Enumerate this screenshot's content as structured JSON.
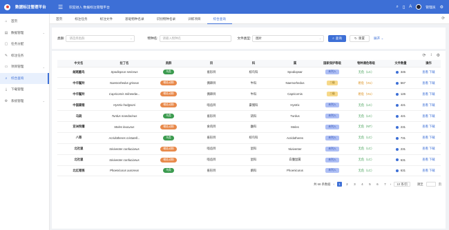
{
  "header": {
    "app_title": "数据标注管理平台",
    "welcome": "欢迎进入 数据标注管理平台",
    "user_name": "管理员"
  },
  "sidebar": {
    "items": [
      {
        "label": "首页",
        "icon": "home-icon",
        "has_children": false
      },
      {
        "label": "数据管理",
        "icon": "database-icon",
        "has_children": true
      },
      {
        "label": "任务分配",
        "icon": "task-icon",
        "has_children": false
      },
      {
        "label": "标注任务",
        "icon": "edit-icon",
        "has_children": false
      },
      {
        "label": "项目管理",
        "icon": "folder-icon",
        "has_children": true
      },
      {
        "label": "综合查询",
        "icon": "search-icon",
        "has_children": false,
        "active": true
      },
      {
        "label": "下载管理",
        "icon": "download-icon",
        "has_children": false
      },
      {
        "label": "系统管理",
        "icon": "gear-icon",
        "has_children": true
      }
    ]
  },
  "tabs": [
    {
      "label": "首页",
      "active": false
    },
    {
      "label": "标注任务",
      "active": false
    },
    {
      "label": "标注文件",
      "active": false
    },
    {
      "label": "基础物种名录",
      "active": false
    },
    {
      "label": "识别物种名录",
      "active": false
    },
    {
      "label": "训练项目",
      "active": false
    },
    {
      "label": "综合查询",
      "active": true
    }
  ],
  "filter": {
    "category_label": "类群:",
    "category_placeholder": "请选择类群",
    "species_label": "物种名:",
    "species_placeholder": "请输入物种名",
    "filetype_label": "文件类型:",
    "filetype_value": "图片",
    "query_label": "查询",
    "reset_label": "重置",
    "expand_label": "展开"
  },
  "table": {
    "columns": [
      "中文名",
      "拉丁名",
      "类群",
      "目",
      "科",
      "属",
      "国家保护等级",
      "物种濒危等级",
      "文件数量",
      "操作"
    ],
    "rows": [
      {
        "cn": "絨尾鼯鸟",
        "latin": "Spodiopsar sericeus",
        "group": "鸟类",
        "group_color": "green",
        "order": "雀形目",
        "family": "椋鸟科",
        "genus": "Spodiopsar",
        "protect": "未列入",
        "protect_color": "blue",
        "iucn": "无危（LC）",
        "iucn_color": "green",
        "files": "345"
      },
      {
        "cn": "中华鬣羚",
        "latin": "Naemorhedus griseus",
        "group": "哺乳动物",
        "group_color": "orange",
        "order": "偶蹄目",
        "family": "牛科",
        "genus": "Naemorhedus",
        "protect": "二级",
        "protect_color": "yellow",
        "iucn": "易危（VU）",
        "iucn_color": "orange",
        "files": "567"
      },
      {
        "cn": "中华鬣羚",
        "latin": "Capricornis milneedw...",
        "group": "哺乳动物",
        "group_color": "orange",
        "order": "偶蹄目",
        "family": "牛科",
        "genus": "Capricornis",
        "protect": "二级",
        "protect_color": "yellow",
        "iucn": "易危（VU）",
        "iucn_color": "orange",
        "files": "126"
      },
      {
        "cn": "中国豪猪",
        "latin": "Hystrix hodgsoni",
        "group": "哺乳动物",
        "group_color": "orange",
        "order": "啮齿目",
        "family": "豪猪科",
        "genus": "Hystrix",
        "protect": "未列入",
        "protect_color": "blue",
        "iucn": "无危（LC）",
        "iucn_color": "green",
        "files": "421"
      },
      {
        "cn": "乌鸫",
        "latin": "Turdus mandarinus",
        "group": "鸟类",
        "group_color": "green",
        "order": "雀形目",
        "family": "鸫科",
        "genus": "Turdus",
        "protect": "未列入",
        "protect_color": "blue",
        "iucn": "无危（LC）",
        "iucn_color": "green",
        "files": "421"
      },
      {
        "cn": "亚洲狗獾",
        "latin": "Meles leucurus",
        "group": "哺乳动物",
        "group_color": "orange",
        "order": "食肉目",
        "family": "鼬科",
        "genus": "Meles",
        "protect": "未列入",
        "protect_color": "blue",
        "iucn": "无危（NT）",
        "iucn_color": "green",
        "files": "231"
      },
      {
        "cn": "八哥",
        "latin": "Acridotheres cristatell...",
        "group": "鸟类",
        "group_color": "green",
        "order": "雀形目",
        "family": "椋鸟科",
        "genus": "Acridotheres",
        "protect": "未列入",
        "protect_color": "blue",
        "iucn": "无危（LC）",
        "iucn_color": "green",
        "files": "731"
      },
      {
        "cn": "北社鼠",
        "latin": "Niviventer confucianus",
        "group": "哺乳动物",
        "group_color": "orange",
        "order": "啮齿目",
        "family": "鼠科",
        "genus": "Niviventer",
        "protect": "未列入",
        "protect_color": "blue",
        "iucn": "无危（LC）",
        "iucn_color": "green",
        "files": "231"
      },
      {
        "cn": "北社鼠",
        "latin": "Niviventer confucianus",
        "group": "哺乳动物",
        "group_color": "orange",
        "order": "啮齿目",
        "family": "鼠科",
        "genus": "白腹鼠属",
        "protect": "未列入",
        "protect_color": "blue",
        "iucn": "无危（LC）",
        "iucn_color": "green",
        "files": "631"
      },
      {
        "cn": "北红尾鸲",
        "latin": "Phoenicurus auroreus",
        "group": "鸟类",
        "group_color": "green",
        "order": "雀形目",
        "family": "鹟科",
        "genus": "Phoenicurus",
        "protect": "未列入",
        "protect_color": "blue",
        "iucn": "无危（LC）",
        "iucn_color": "green",
        "files": "631"
      }
    ],
    "view_label": "查看",
    "download_label": "下载"
  },
  "pager": {
    "total": "共 68 条数据",
    "pages": [
      "1",
      "2",
      "3",
      "4",
      "5",
      "6",
      "7"
    ],
    "current": "1",
    "page_size": "10 条/页",
    "jump_label": "跳至",
    "page_unit": "页"
  },
  "colors": {
    "primary": "#3d6fd6",
    "green": "#3b9b4f",
    "orange": "#e8894a"
  }
}
